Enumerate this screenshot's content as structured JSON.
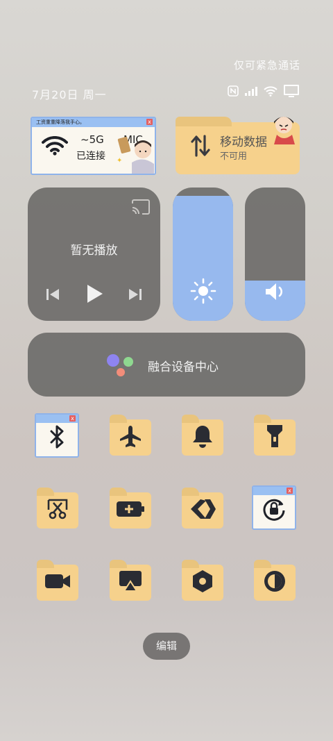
{
  "header": {
    "emergency_text": "仅可紧急通话",
    "date_text": "7月20日 周一"
  },
  "status_icons": [
    "nfc-icon",
    "signal-icon",
    "wifi-icon",
    "screen-icon"
  ],
  "wifi_card": {
    "title_text": "工资重重降落我手心。",
    "band": "5G",
    "mic_text": "MIC",
    "status": "已连接",
    "icon": "wifi-icon"
  },
  "mobile_data": {
    "title": "移动数据",
    "status": "不可用",
    "icon": "data-arrows-icon"
  },
  "media": {
    "status": "暂无播放",
    "controls": [
      "previous-icon",
      "play-icon",
      "next-icon"
    ],
    "cast_icon": "cast-icon"
  },
  "sliders": {
    "brightness_level": 0.94,
    "volume_level": 0.3
  },
  "hub": {
    "label": "融合设备中心"
  },
  "tiles": [
    {
      "name": "bluetooth",
      "style": "window"
    },
    {
      "name": "airplane-mode",
      "style": "folder"
    },
    {
      "name": "ring-mode",
      "style": "folder"
    },
    {
      "name": "flashlight",
      "style": "folder"
    },
    {
      "name": "screenshot",
      "style": "folder"
    },
    {
      "name": "battery-saver",
      "style": "folder"
    },
    {
      "name": "share-link",
      "style": "folder"
    },
    {
      "name": "rotation-lock",
      "style": "window"
    },
    {
      "name": "screen-record",
      "style": "folder"
    },
    {
      "name": "screen-mirror",
      "style": "folder"
    },
    {
      "name": "settings",
      "style": "folder"
    },
    {
      "name": "dark-mode",
      "style": "folder"
    }
  ],
  "edit_button": {
    "label": "编辑"
  },
  "colors": {
    "folder": "#f6d18c",
    "accent_blue": "#97b9ee",
    "panel_gray": "#6e6c6a",
    "icon_dark": "#2a2c33"
  }
}
